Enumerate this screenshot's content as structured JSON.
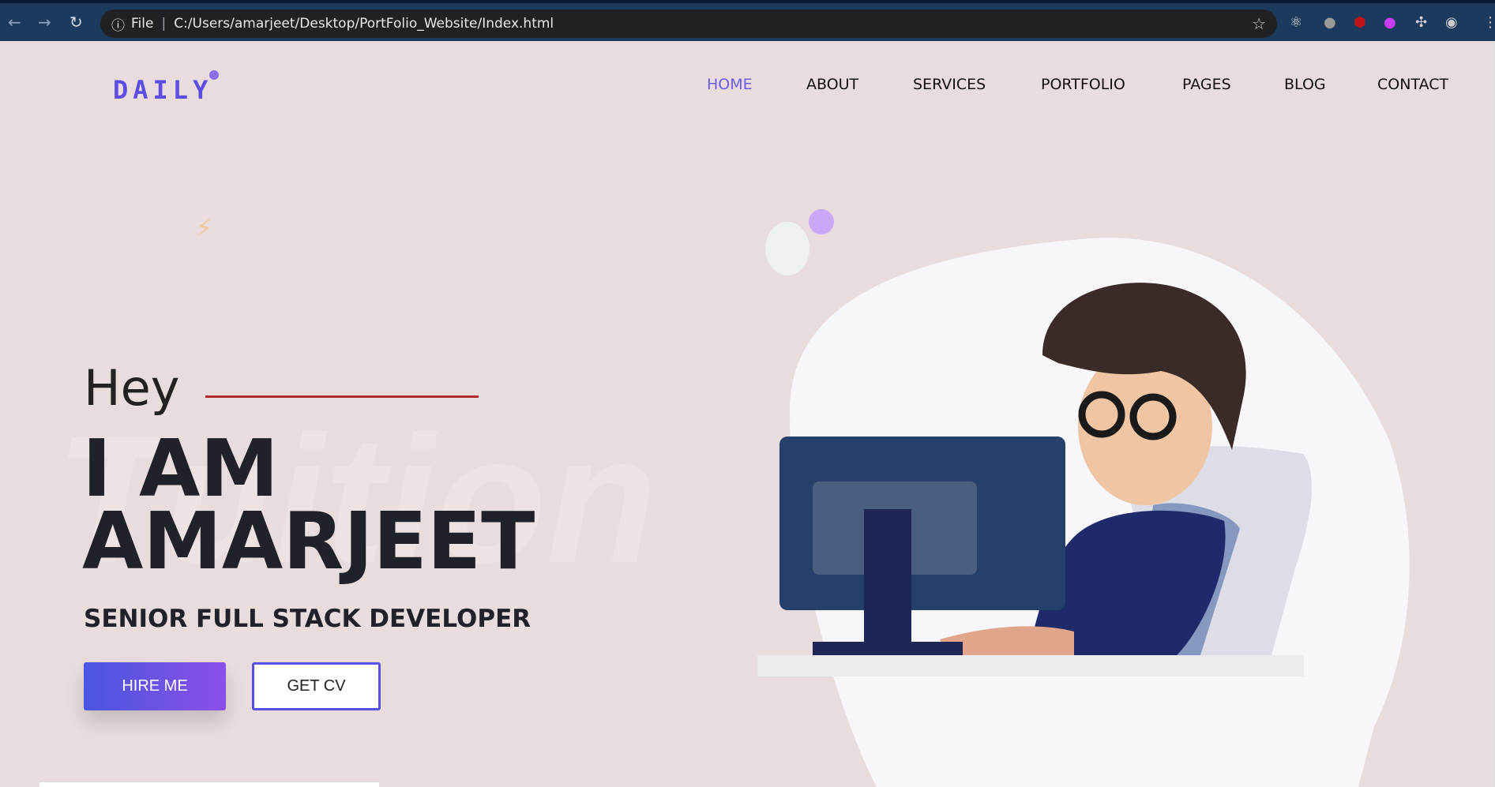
{
  "browser": {
    "url_prefix": "File",
    "url": "C:/Users/amarjeet/Desktop/PortFolio_Website/Index.html"
  },
  "logo": "DAILY",
  "nav": [
    "HOME",
    "ABOUT",
    "SERVICES",
    "PORTFOLIO",
    "PAGES",
    "BLOG",
    "CONTACT"
  ],
  "active_nav": "HOME",
  "hero": {
    "greeting": "Hey",
    "line1": "I AM",
    "line2": "AMARJEET",
    "role": "SENIOR FULL STACK DEVELOPER",
    "watermark": "Tuition",
    "hire_label": "HIRE ME",
    "cv_label": "GET CV"
  },
  "colors": {
    "accent": "#6b5ce7",
    "background": "#e8dcdc",
    "line": "#b02a2a"
  }
}
